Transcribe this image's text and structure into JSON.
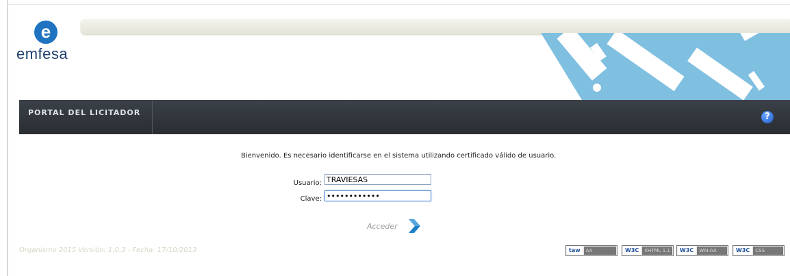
{
  "logo": {
    "letter": "e",
    "name": "emfesa"
  },
  "header": {
    "portal_title": "PORTAL DEL LICITADOR"
  },
  "main": {
    "welcome_text": "Bienvenido. Es necesario identificarse en el sistema utilizando certificado válido de usuario.",
    "usuario_label": "Usuario:",
    "usuario_value": "TRAVIESAS",
    "clave_label": "Clave:",
    "clave_value": "••••••••••••",
    "acceder_label": "Acceder"
  },
  "footer": {
    "version_text": "Organismo 2015 Versión: 1.0.3 - Fecha: 17/10/2013",
    "badges": [
      {
        "left": "taw",
        "right": "AA"
      },
      {
        "left": "W3C",
        "right": "XHTML 1.1"
      },
      {
        "left": "W3C",
        "right": "WAI-AA"
      },
      {
        "left": "W3C",
        "right": "CSS"
      }
    ]
  },
  "colors": {
    "navbar": "#30353b",
    "banner_accent": "#7fbfe0",
    "logo_blue": "#1f73c0",
    "acceder_arrow": "#1e7fc7"
  }
}
